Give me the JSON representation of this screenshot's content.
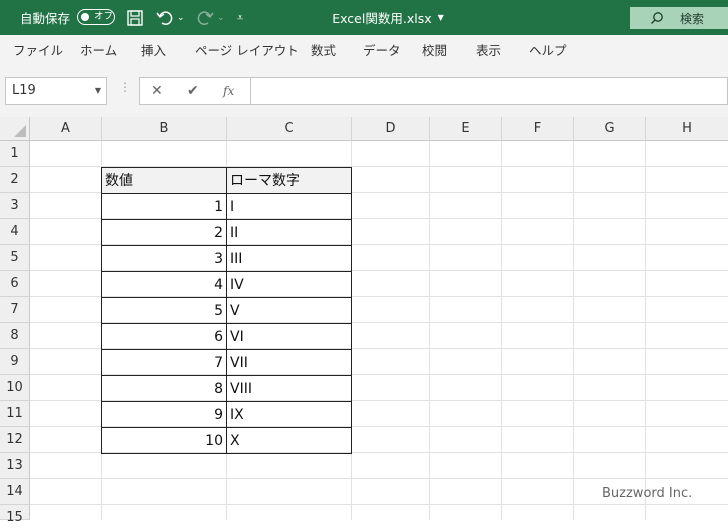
{
  "titlebar": {
    "autosave_label": "自動保存",
    "autosave_state": "オフ",
    "document_title": "Excel関数用.xlsx",
    "search_label": "検索"
  },
  "ribbon_tabs": [
    "ファイル",
    "ホーム",
    "挿入",
    "ページ レイアウト",
    "数式",
    "データ",
    "校閲",
    "表示",
    "ヘルプ"
  ],
  "formula_bar": {
    "name_box": "L19",
    "fx_label": "fx",
    "formula": ""
  },
  "sheet": {
    "columns": [
      "A",
      "B",
      "C",
      "D",
      "E",
      "F",
      "G",
      "H"
    ],
    "rows": [
      "1",
      "2",
      "3",
      "4",
      "5",
      "6",
      "7",
      "8",
      "9",
      "10",
      "11",
      "12",
      "13",
      "14",
      "15"
    ],
    "table": {
      "headers": [
        "数値",
        "ローマ数字"
      ],
      "rows": [
        [
          "1",
          "I"
        ],
        [
          "2",
          "II"
        ],
        [
          "3",
          "III"
        ],
        [
          "4",
          "IV"
        ],
        [
          "5",
          "V"
        ],
        [
          "6",
          "VI"
        ],
        [
          "7",
          "VII"
        ],
        [
          "8",
          "VIII"
        ],
        [
          "9",
          "IX"
        ],
        [
          "10",
          "X"
        ]
      ]
    }
  },
  "watermark": "Buzzword Inc.",
  "colors": {
    "titlebar": "#217346",
    "search_box": "#a9d3b9",
    "ribbon": "#f3f3f3",
    "header_fill": "#f2f2f2"
  }
}
